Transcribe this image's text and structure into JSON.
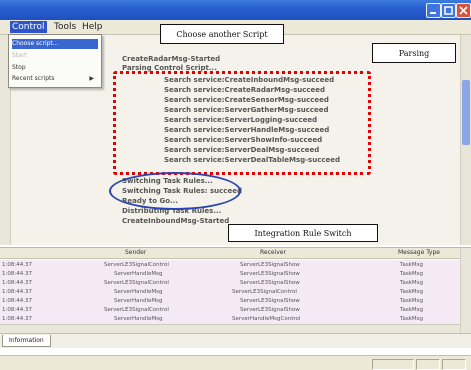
{
  "window": {
    "minimize_icon": "minimize-icon",
    "maximize_icon": "maximize-icon",
    "close_icon": "close-icon"
  },
  "menu": {
    "items": [
      "Control",
      "Tools",
      "Help"
    ]
  },
  "dropdown": {
    "items": [
      {
        "label": "Choose script...",
        "state": "highlighted"
      },
      {
        "label": "Start",
        "state": "disabled"
      },
      {
        "label": "Stop",
        "state": "normal"
      },
      {
        "label": "Recent scripts",
        "state": "normal",
        "submenu": true
      }
    ]
  },
  "callouts": {
    "choose_script": "Choose another Script",
    "parsing": "Parsing",
    "integration": "Integration Rule Switch"
  },
  "log": {
    "lines": [
      "CreateRadarMsg-Started",
      "Parsing Control Script...",
      "Search service:CreateInboundMsg-succeed",
      "Search service:CreateRadarMsg-succeed",
      "Search service:CreateSensorMsg-succeed",
      "Search service:ServerGatherMsg-succeed",
      "Search service:ServerLogging-succeed",
      "Search service:ServerHandleMsg-succeed",
      "Search service:ServerShowInfo-succeed",
      "Search service:ServerDealMsg-succeed",
      "Search service:ServerDealTableMsg-succeed",
      "Switching Task Rules...",
      "Switching Task Rules: succeed",
      "Ready to Go...",
      "Distributing Task Rules...",
      "CreateInboundMsg-Started"
    ]
  },
  "table": {
    "headers": [
      "Sender",
      "Receiver",
      "Message Type"
    ],
    "rows": [
      {
        "time": "1:08:44.37",
        "sender": "ServerLE3SignalControl",
        "receiver": "ServerLE3SignalShow",
        "type": "TaskMsg"
      },
      {
        "time": "1:08:44.37",
        "sender": "ServerHandleMsg",
        "receiver": "ServerLE3SignalShow",
        "type": "TaskMsg"
      },
      {
        "time": "1:08:44.37",
        "sender": "ServerLE3SignalControl",
        "receiver": "ServerLE3SignalShow",
        "type": "TaskMsg"
      },
      {
        "time": "1:08:44.37",
        "sender": "ServerHandleMsg",
        "receiver": "ServerLE3SignalControl",
        "type": "TaskMsg"
      },
      {
        "time": "1:08:44.37",
        "sender": "ServerHandleMsg",
        "receiver": "ServerLE3SignalShow",
        "type": "TaskMsg"
      },
      {
        "time": "1:08:44.37",
        "sender": "ServerLE3SignalControl",
        "receiver": "ServerLE3SignalShow",
        "type": "TaskMsg"
      },
      {
        "time": "1:08:44.37",
        "sender": "ServerHandleMsg",
        "receiver": "ServerHandleMsgControl",
        "type": "TaskMsg"
      }
    ]
  },
  "tabs": [
    "Information"
  ],
  "status": {
    "cells": [
      "",
      "",
      ""
    ]
  },
  "colors": {
    "annotation_red": "#e20000",
    "annotation_blue": "#2a46b0",
    "titlebar_blue": "#2a5fd0"
  }
}
